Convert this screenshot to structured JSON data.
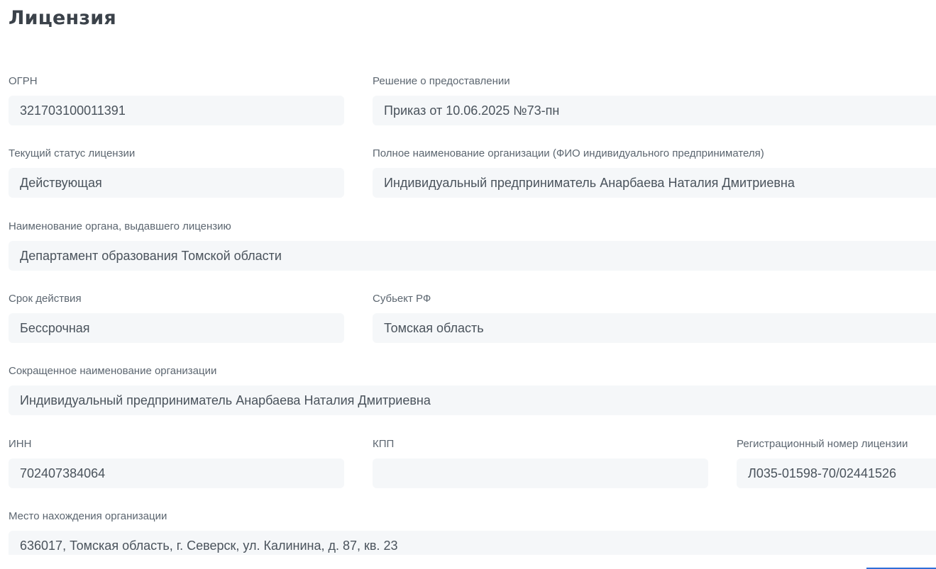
{
  "page": {
    "title": "Лицензия"
  },
  "fields": {
    "ogrn": {
      "label": "ОГРН",
      "value": "321703100011391"
    },
    "decision": {
      "label": "Решение о предоставлении",
      "value": "Приказ от 10.06.2025 №73-пн"
    },
    "status": {
      "label": "Текущий статус лицензии",
      "value": "Действующая"
    },
    "full_name": {
      "label": "Полное наименование организации (ФИО индивидуального предпринимателя)",
      "value": "Индивидуальный предприниматель Анарбаева Наталия Дмитриевна"
    },
    "issuer": {
      "label": "Наименование органа, выдавшего лицензию",
      "value": "Департамент образования Томской области"
    },
    "validity": {
      "label": "Срок действия",
      "value": "Бессрочная"
    },
    "region": {
      "label": "Субьект РФ",
      "value": "Томская область"
    },
    "short_name": {
      "label": "Сокращенное наименование организации",
      "value": "Индивидуальный предприниматель Анарбаева Наталия Дмитриевна"
    },
    "inn": {
      "label": "ИНН",
      "value": "702407384064"
    },
    "kpp": {
      "label": "КПП",
      "value": ""
    },
    "reg_number": {
      "label": "Регистрационный номер лицензии",
      "value": "Л035-01598-70/02441526"
    },
    "address": {
      "label": "Место нахождения организации",
      "value": "636017, Томская область, г. Северск, ул. Калинина, д. 87, кв. 23"
    }
  },
  "colors": {
    "field_background": "#f5f7f9",
    "label_text": "#5c6670",
    "value_text": "#4a535c",
    "title_text": "#3b424a",
    "accent": "#2f6fd8"
  }
}
